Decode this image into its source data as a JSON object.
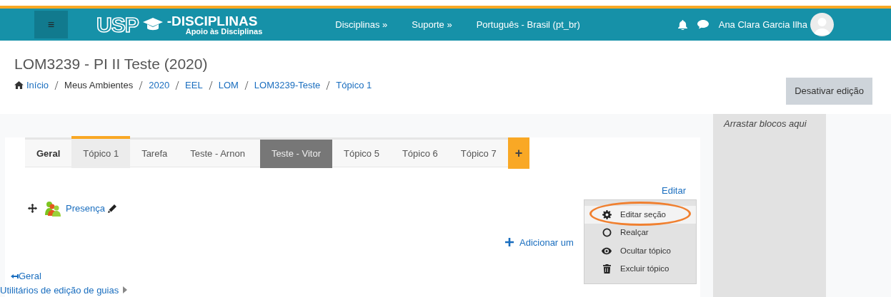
{
  "navbar": {
    "menu_button": "≡",
    "logo": {
      "mark": "USP",
      "name": "-DISCIPLINAS",
      "tagline": "Apoio às Disciplinas"
    },
    "menu": [
      "Disciplinas »",
      "Suporte »",
      "Português - Brasil (pt_br)"
    ],
    "user": "Ana Clara Garcia Ilha"
  },
  "header": {
    "title": "LOM3239 - PI II Teste (2020)",
    "breadcrumb": [
      {
        "label": "Início",
        "kind": "link"
      },
      {
        "label": "Meus Ambientes",
        "kind": "plain"
      },
      {
        "label": "2020",
        "kind": "link"
      },
      {
        "label": "EEL",
        "kind": "link"
      },
      {
        "label": "LOM",
        "kind": "link"
      },
      {
        "label": "LOM3239-Teste",
        "kind": "link"
      },
      {
        "label": "Tópico 1",
        "kind": "link"
      }
    ],
    "edit_button": "Desativar edição"
  },
  "tabs": [
    {
      "kind": "general",
      "label": "Geral",
      "selected": false,
      "hidden": false
    },
    {
      "kind": "topic",
      "label": "Tópico 1",
      "selected": true,
      "hidden": false
    },
    {
      "kind": "topic",
      "label": "Tarefa",
      "selected": false,
      "hidden": false
    },
    {
      "kind": "topic",
      "label": "Teste - Arnon",
      "selected": false,
      "hidden": false
    },
    {
      "kind": "topic",
      "label": "Teste - Vitor",
      "selected": false,
      "hidden": true
    },
    {
      "kind": "topic",
      "label": "Tópico 5",
      "selected": false,
      "hidden": false
    },
    {
      "kind": "topic",
      "label": "Tópico 6",
      "selected": false,
      "hidden": false
    },
    {
      "kind": "topic",
      "label": "Tópico 7",
      "selected": false,
      "hidden": false
    }
  ],
  "add_tab": "+",
  "section": {
    "edit_link": "Editar",
    "activity": "Presença",
    "add_link": "Adicionar um",
    "menu": [
      {
        "kind": "gear",
        "label": "Editar seção",
        "selected": true,
        "highlighted": true
      },
      {
        "kind": "circle",
        "label": "Realçar",
        "selected": false,
        "highlighted": false
      },
      {
        "kind": "eye",
        "label": "Ocultar tópico",
        "selected": false,
        "highlighted": false
      },
      {
        "kind": "trash",
        "label": "Excluir tópico",
        "selected": false,
        "highlighted": false
      }
    ]
  },
  "footer_links": {
    "back": "Geral",
    "utilities": "Utilitários de edição de guias"
  },
  "blocks": {
    "drop_hint": "Arrastar blocos aqui"
  }
}
